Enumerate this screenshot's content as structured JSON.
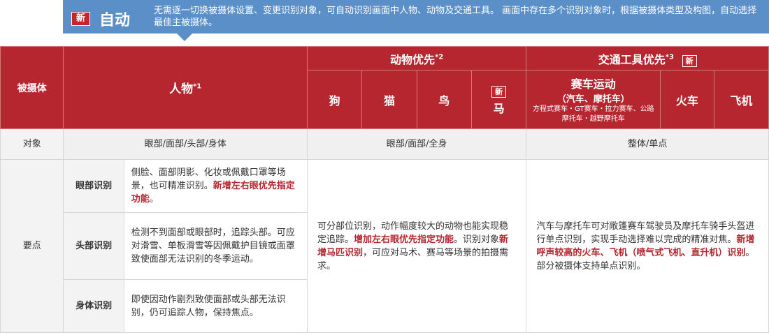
{
  "callout": {
    "badge": "新",
    "title": "自动",
    "description": "无需逐一切换被摄体设置、变更识别对象，可自动识别画面中人物、动物及交通工具。 画面中存在多个识别对象时，根据被摄体类型及构图，自动选择最佳主被摄体。"
  },
  "header": {
    "subject_label": "被摄体",
    "person": "人物",
    "person_note": "*1",
    "animal_group": "动物优先",
    "animal_note": "*2",
    "vehicle_group": "交通工具优先",
    "vehicle_note": "*3",
    "vehicle_badge": "新",
    "animals": [
      "狗",
      "猫",
      "鸟"
    ],
    "horse": "马",
    "horse_badge": "新",
    "racing_title": "赛车运动",
    "racing_subtitle": "（汽车、摩托车）",
    "racing_detail": "方程式赛车・GT赛车・拉力赛车、公路摩托车・越野摩托车",
    "train": "火车",
    "airplane": "飞机"
  },
  "target_row": {
    "label": "对象",
    "person": "眼部/面部/头部/身体",
    "animal": "眼部/面部/全身",
    "vehicle": "整体/单点"
  },
  "points": {
    "label": "要点",
    "eye_label": "眼部识别",
    "eye_text": "侧脸、面部阴影、化妆或佩戴口罩等场景，也可精准识别。",
    "eye_hl": "新增左右眼优先指定功能",
    "eye_end": "。",
    "head_label": "头部识别",
    "head_text": "检测不到面部或眼部时，追踪头部。可应对滑雪、单板滑雪等因佩戴护目镜或面罩致使面部无法识别的冬季运动。",
    "body_label": "身体识别",
    "body_text": "即使因动作剧烈致使面部或头部无法识别，仍可追踪人物，保持焦点。",
    "animal_text1": "可分部位识别，动作幅度较大的动物也能实现稳定追踪。",
    "animal_hl1": "增加左右眼优先指定功能",
    "animal_text2": "。识别对象",
    "animal_hl2": "新增马匹识别",
    "animal_text3": "，可应对马术、赛马等场景的拍摄需求。",
    "vehicle_text1": "汽车与摩托车可对敞篷赛车驾驶员及摩托车骑手头盔进行单点识别，实现手动选择难以完成的精准对焦。",
    "vehicle_hl": "新增呼声较高的火车、飞机（喷气式飞机、直升机）识别",
    "vehicle_text2": "。部分被摄体支持单点识别。"
  },
  "colors": {
    "header_red": "#b5262e",
    "callout_blue": "#5a8fc8",
    "highlight": "#b5262e"
  }
}
